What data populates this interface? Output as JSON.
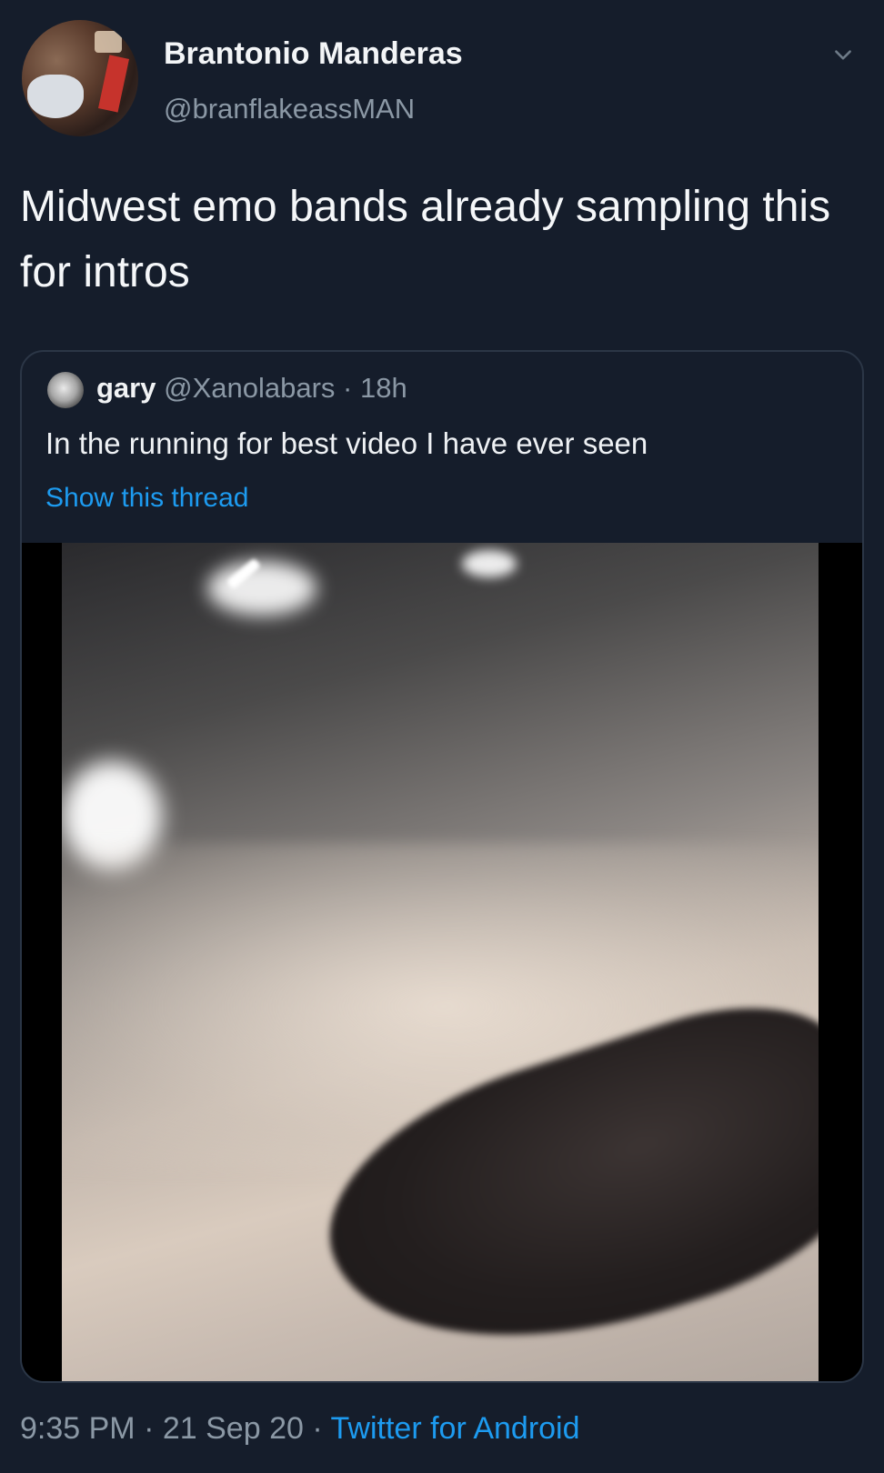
{
  "tweet": {
    "display_name": "Brantonio Manderas",
    "handle": "@branflakeassMAN",
    "text": "Midwest emo bands already sampling this for intros",
    "timestamp": "9:35 PM",
    "separator": "·",
    "date": "21 Sep 20",
    "source": "Twitter for Android"
  },
  "quoted_tweet": {
    "display_name": "gary",
    "handle": "@Xanolabars",
    "age": "18h",
    "text": "In the running for best video I have ever seen",
    "show_thread_label": "Show this thread"
  },
  "colors": {
    "background": "#151d2b",
    "link": "#1d9bf0",
    "secondary_text": "#8b98a5"
  },
  "icons": {
    "caret": "chevron-down-icon",
    "avatar": "avatar",
    "quoted_avatar": "avatar"
  }
}
